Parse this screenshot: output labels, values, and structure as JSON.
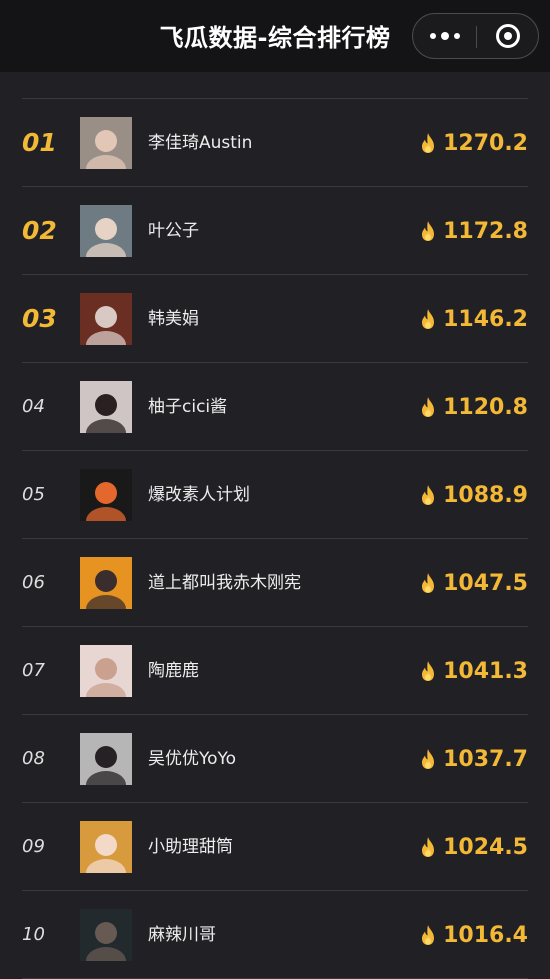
{
  "header": {
    "title": "飞瓜数据-综合排行榜",
    "more_icon": "more-dots-icon",
    "close_icon": "close-circle-icon"
  },
  "colors": {
    "accent": "#f2b836",
    "background": "#212125",
    "header_bg": "#141416",
    "divider": "#3a3a40"
  },
  "rankings": [
    {
      "rank": "01",
      "name": "李佳琦Austin",
      "score": "1270.2",
      "avatar_bg": "#9a8f86",
      "avatar_fg": "#e2c7b6"
    },
    {
      "rank": "02",
      "name": "叶公子",
      "score": "1172.8",
      "avatar_bg": "#6f7b83",
      "avatar_fg": "#e6d3c6"
    },
    {
      "rank": "03",
      "name": "韩美娟",
      "score": "1146.2",
      "avatar_bg": "#6b2e23",
      "avatar_fg": "#d8c9c4"
    },
    {
      "rank": "04",
      "name": "柚子cici酱",
      "score": "1120.8",
      "avatar_bg": "#cfc5c4",
      "avatar_fg": "#2a2022"
    },
    {
      "rank": "05",
      "name": "爆改素人计划",
      "score": "1088.9",
      "avatar_bg": "#191919",
      "avatar_fg": "#e4672d"
    },
    {
      "rank": "06",
      "name": "道上都叫我赤木刚宪",
      "score": "1047.5",
      "avatar_bg": "#e79322",
      "avatar_fg": "#3b2d2e"
    },
    {
      "rank": "07",
      "name": "陶鹿鹿",
      "score": "1041.3",
      "avatar_bg": "#e8d6d2",
      "avatar_fg": "#caa08e"
    },
    {
      "rank": "08",
      "name": "吴优优YoYo",
      "score": "1037.7",
      "avatar_bg": "#b7b6b6",
      "avatar_fg": "#262124"
    },
    {
      "rank": "09",
      "name": "小助理甜筒",
      "score": "1024.5",
      "avatar_bg": "#d79a3c",
      "avatar_fg": "#f2d9c8"
    },
    {
      "rank": "10",
      "name": "麻辣川哥",
      "score": "1016.4",
      "avatar_bg": "#232a2d",
      "avatar_fg": "#665a52"
    }
  ]
}
